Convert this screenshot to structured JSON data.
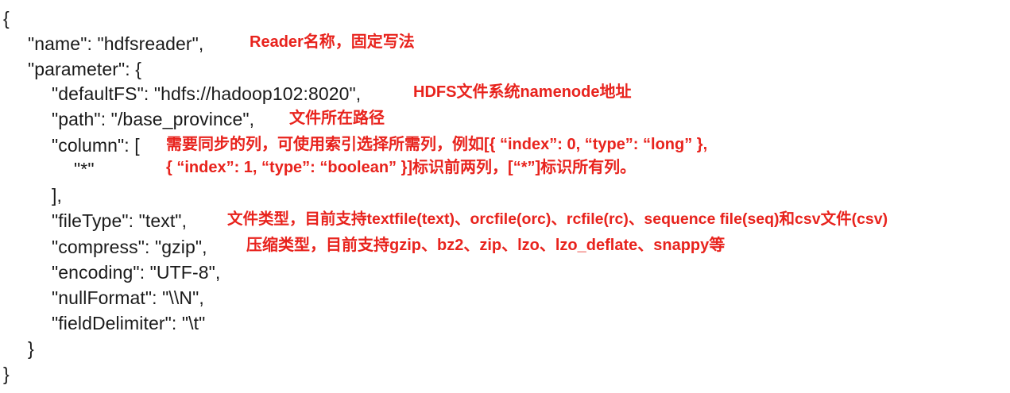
{
  "code": {
    "open_brace": "{",
    "name_line": "\"name\": \"hdfsreader\",",
    "parameter_line": "\"parameter\": {",
    "defaultfs_line": "\"defaultFS\": \"hdfs://hadoop102:8020\",",
    "path_line": "\"path\": \"/base_province\",",
    "column_line": "\"column\": [",
    "star_line": "\"*\"",
    "column_close": "],",
    "filetype_line": "\"fileType\": \"text\",",
    "compress_line": "\"compress\": \"gzip\",",
    "encoding_line": "\"encoding\": \"UTF-8\",",
    "nullformat_line": "\"nullFormat\": \"\\\\N\",",
    "fielddelimiter_line": "\"fieldDelimiter\": \"\\t\"",
    "param_close": "}",
    "close_brace": "}"
  },
  "notes": {
    "name": "Reader名称，固定写法",
    "defaultfs": "HDFS文件系统namenode地址",
    "path": "文件所在路径",
    "column_1": "需要同步的列，可使用索引选择所需列，例如[{ “index”: 0, “type”: “long” },",
    "column_2": "{ “index”: 1, “type”: “boolean” }]标识前两列，[“*”]标识所有列。",
    "filetype": "文件类型，目前支持textfile(text)、orcfile(orc)、rcfile(rc)、sequence file(seq)和csv文件(csv)",
    "compress": "压缩类型，目前支持gzip、bz2、zip、lzo、lzo_deflate、snappy等"
  },
  "colors": {
    "code_text": "#1a1a1a",
    "annotation": "#e8231d",
    "background": "#ffffff"
  }
}
